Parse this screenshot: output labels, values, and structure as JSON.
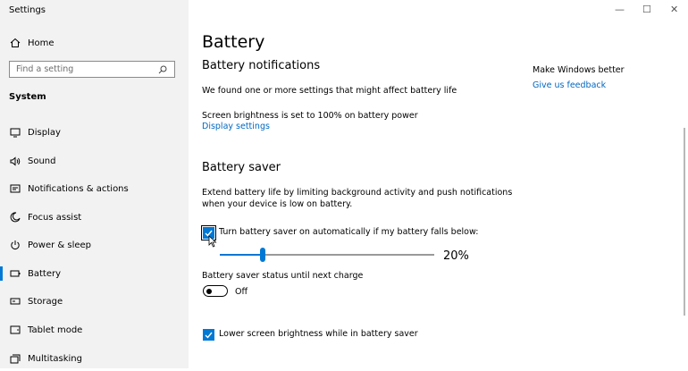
{
  "window": {
    "title": "Settings",
    "minimize": "—",
    "maximize": "☐",
    "close": "✕"
  },
  "sidebar": {
    "home_label": "Home",
    "search_placeholder": "Find a setting",
    "section_label": "System",
    "items": [
      {
        "label": "Display",
        "icon": "display-icon"
      },
      {
        "label": "Sound",
        "icon": "speaker-icon"
      },
      {
        "label": "Notifications & actions",
        "icon": "notifications-icon"
      },
      {
        "label": "Focus assist",
        "icon": "moon-icon"
      },
      {
        "label": "Power & sleep",
        "icon": "power-icon"
      },
      {
        "label": "Battery",
        "icon": "battery-icon",
        "active": true
      },
      {
        "label": "Storage",
        "icon": "storage-icon"
      },
      {
        "label": "Tablet mode",
        "icon": "tablet-icon"
      },
      {
        "label": "Multitasking",
        "icon": "multitasking-icon"
      }
    ]
  },
  "main": {
    "title": "Battery",
    "notifications": {
      "heading": "Battery notifications",
      "message": "We found one or more settings that might affect battery life",
      "brightness_note": "Screen brightness is set to 100% on battery power",
      "link": "Display settings"
    },
    "saver": {
      "heading": "Battery saver",
      "description_line1": "Extend battery life by limiting background activity and push notifications",
      "description_line2": "when your device is low on battery.",
      "auto_checkbox_label": "Turn battery saver on automatically if my battery falls below:",
      "auto_checkbox_checked": true,
      "threshold_value": "20%",
      "threshold_percent": 20,
      "status_label": "Battery saver status until next charge",
      "toggle_state": "Off",
      "lower_brightness_label": "Lower screen brightness while in battery saver",
      "lower_brightness_checked": true
    }
  },
  "aside": {
    "heading": "Make Windows better",
    "link": "Give us feedback"
  },
  "colors": {
    "accent": "#0078d4",
    "link": "#0067c0",
    "sidebar_bg": "#f2f2f2"
  }
}
